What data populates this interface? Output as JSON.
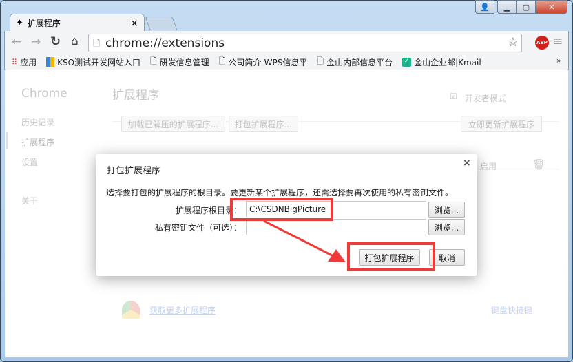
{
  "window": {
    "controls": [
      "user-icon",
      "minimize-icon",
      "maximize-icon",
      "close-icon"
    ]
  },
  "tab": {
    "title": "扩展程序",
    "close": "×"
  },
  "omnibox": {
    "url": "chrome://extensions",
    "abp": "ABP"
  },
  "bookmarks": [
    {
      "label": "应用",
      "icon": "apps-grid-icon"
    },
    {
      "label": "KSO测试开发网站入口",
      "icon": "wps-icon"
    },
    {
      "label": "研发信息管理",
      "icon": "page-icon"
    },
    {
      "label": "公司简介-WPS信息平",
      "icon": "page-icon"
    },
    {
      "label": "金山内部信息平台",
      "icon": "page-icon"
    },
    {
      "label": "金山企业邮|Kmail",
      "icon": "mail-icon"
    }
  ],
  "bookmarks_more": "»",
  "sidebar": {
    "brand": "Chrome",
    "items": [
      {
        "label": "历史记录"
      },
      {
        "label": "扩展程序",
        "selected": true
      },
      {
        "label": "设置"
      },
      {
        "label": "关于"
      }
    ]
  },
  "main": {
    "title": "扩展程序",
    "dev_mode": "开发者模式",
    "dev_mode_checked": true,
    "load_unpacked": "加载已解压的扩展程序...",
    "pack": "打包扩展程序...",
    "update": "立即更新扩展程序",
    "enable_partial": "启用",
    "get_more": "获取更多扩展程序",
    "shortcuts": "键盘快捷键"
  },
  "dialog": {
    "title": "打包扩展程序",
    "close": "×",
    "description": "选择要打包的扩展程序的根目录。要更新某个扩展程序，还需选择要再次使用的私有密钥文件。",
    "root_label": "扩展程序根目录：",
    "root_value": "C:\\CSDNBigPicture",
    "key_label": "私有密钥文件（可选）：",
    "key_value": "",
    "browse": "浏览...",
    "pack": "打包扩展程序",
    "cancel": "取消"
  },
  "colors": {
    "highlight": "#f03a3a",
    "link": "#c5d3f0"
  }
}
